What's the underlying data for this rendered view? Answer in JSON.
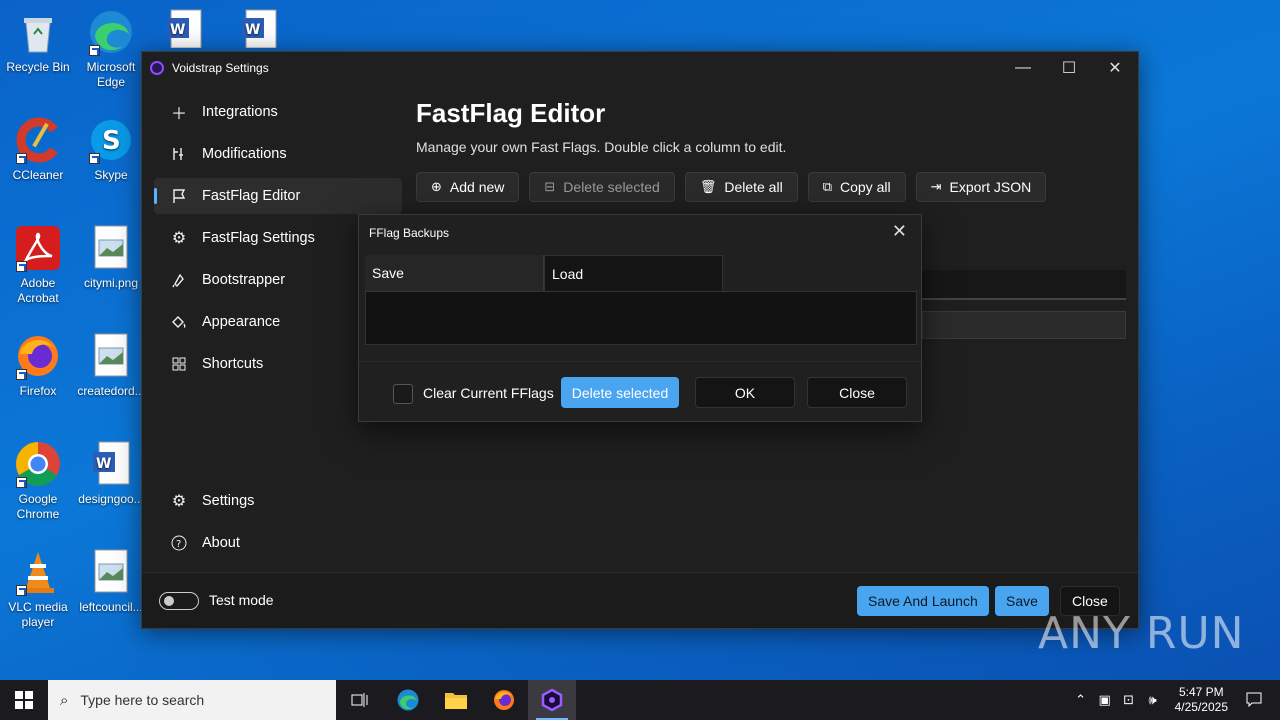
{
  "desktop": {
    "icons": [
      {
        "label": "Recycle Bin"
      },
      {
        "label": "Microsoft Edge"
      },
      {
        "label": "CCleaner"
      },
      {
        "label": "Skype"
      },
      {
        "label": "Adobe Acrobat"
      },
      {
        "label": "citymi.png"
      },
      {
        "label": "Firefox"
      },
      {
        "label": "createdord..."
      },
      {
        "label": "Google Chrome"
      },
      {
        "label": "designgoo..."
      },
      {
        "label": "VLC media player"
      },
      {
        "label": "leftcouncil..."
      }
    ],
    "watermark": "ANY RUN"
  },
  "window": {
    "title": "Voidstrap Settings",
    "controls": {
      "minimize": "—",
      "maximize": "☐",
      "close": "✕"
    }
  },
  "sidebar": {
    "items": [
      {
        "label": "Integrations",
        "icon": "plus-icon"
      },
      {
        "label": "Modifications",
        "icon": "wrench-icon"
      },
      {
        "label": "FastFlag Editor",
        "icon": "flag-icon",
        "active": true
      },
      {
        "label": "FastFlag Settings",
        "icon": "gear-icon"
      },
      {
        "label": "Bootstrapper",
        "icon": "rocket-icon"
      },
      {
        "label": "Appearance",
        "icon": "paint-bucket-icon"
      },
      {
        "label": "Shortcuts",
        "icon": "apps-icon"
      }
    ],
    "bottom_items": [
      {
        "label": "Settings",
        "icon": "gear-icon"
      },
      {
        "label": "About",
        "icon": "question-icon"
      }
    ]
  },
  "main": {
    "title": "FastFlag Editor",
    "description": "Manage your own Fast Flags. Double click a column to edit.",
    "toolbar": {
      "add_new": "Add new",
      "delete_selected": "Delete selected",
      "delete_all": "Delete all",
      "copy_all": "Copy all",
      "export_json": "Export JSON"
    }
  },
  "footer": {
    "test_mode_label": "Test mode",
    "save_and_launch": "Save And Launch",
    "save": "Save",
    "close": "Close"
  },
  "dialog": {
    "title": "FFlag Backups",
    "tabs": [
      "Save",
      "Load"
    ],
    "clear_label": "Clear Current FFlags",
    "delete_selected": "Delete selected",
    "ok": "OK",
    "close": "Close"
  },
  "taskbar": {
    "search_placeholder": "Type here to search",
    "time": "5:47 PM",
    "date": "4/25/2025"
  },
  "colors": {
    "accent": "#4aa5f0",
    "window_bg": "#1f1f1f",
    "desktop_bg": "#0a6fd2"
  }
}
